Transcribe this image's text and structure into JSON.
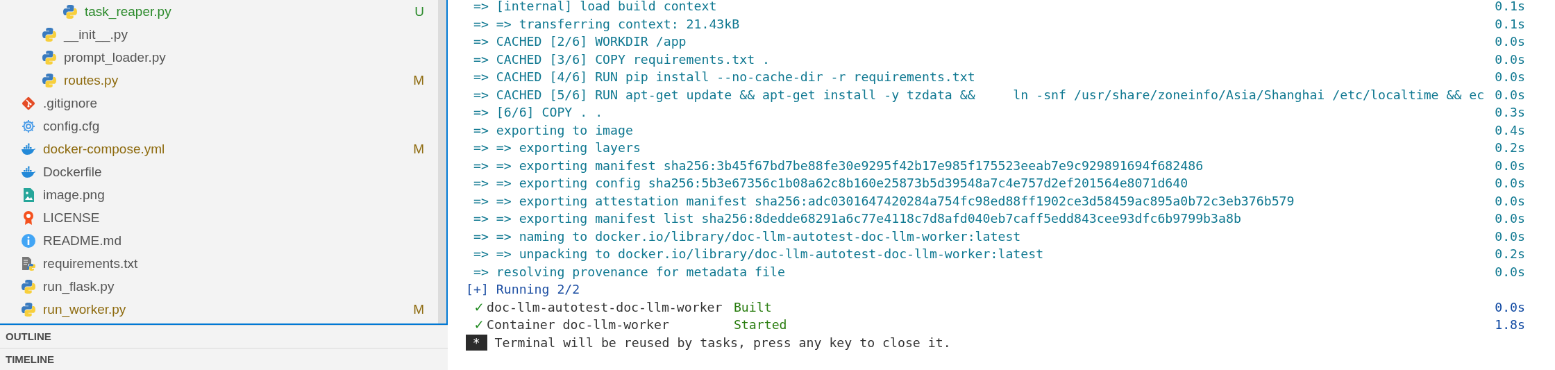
{
  "explorer": {
    "tree": [
      {
        "children": [
          {
            "children": [
              {
                "label": "task_reaper.py",
                "kind": "python",
                "modified": false,
                "untracked": true,
                "badge": "U"
              }
            ]
          },
          {
            "label": "__init__.py",
            "kind": "python",
            "modified": false,
            "untracked": false
          },
          {
            "label": "prompt_loader.py",
            "kind": "python",
            "modified": false,
            "untracked": false
          },
          {
            "label": "routes.py",
            "kind": "python",
            "modified": true,
            "untracked": false,
            "badge": "M"
          }
        ]
      },
      {
        "label": ".gitignore",
        "kind": "git",
        "modified": false,
        "untracked": false
      },
      {
        "label": "config.cfg",
        "kind": "config",
        "modified": false,
        "untracked": false
      },
      {
        "label": "docker-compose.yml",
        "kind": "docker",
        "modified": true,
        "untracked": false,
        "badge": "M"
      },
      {
        "label": "Dockerfile",
        "kind": "docker",
        "modified": false,
        "untracked": false
      },
      {
        "label": "image.png",
        "kind": "image",
        "modified": false,
        "untracked": false
      },
      {
        "label": "LICENSE",
        "kind": "license",
        "modified": false,
        "untracked": false
      },
      {
        "label": "README.md",
        "kind": "readme",
        "modified": false,
        "untracked": false
      },
      {
        "label": "requirements.txt",
        "kind": "requirements",
        "modified": false,
        "untracked": false
      },
      {
        "label": "run_flask.py",
        "kind": "python",
        "modified": false,
        "untracked": false
      },
      {
        "label": "run_worker.py",
        "kind": "python",
        "modified": true,
        "untracked": false,
        "badge": "M"
      }
    ],
    "sections": [
      {
        "label": "OUTLINE"
      },
      {
        "label": "TIMELINE"
      }
    ]
  },
  "terminal": {
    "lines": [
      {
        "kind": "step",
        "text": "=> [internal] load build context",
        "time": "0.1s"
      },
      {
        "kind": "step",
        "text": "=> => transferring context: 21.43kB",
        "time": "0.1s"
      },
      {
        "kind": "step",
        "text": "=> CACHED [2/6] WORKDIR /app",
        "time": "0.0s"
      },
      {
        "kind": "step",
        "text": "=> CACHED [3/6] COPY requirements.txt .",
        "time": "0.0s"
      },
      {
        "kind": "step",
        "text": "=> CACHED [4/6] RUN pip install --no-cache-dir -r requirements.txt",
        "time": "0.0s"
      },
      {
        "kind": "step",
        "text": "=> CACHED [5/6] RUN apt-get update && apt-get install -y tzdata &&     ln -snf /usr/share/zoneinfo/Asia/Shanghai /etc/localtime && ec",
        "time": "0.0s"
      },
      {
        "kind": "step",
        "text": "=> [6/6] COPY . .",
        "time": "0.3s"
      },
      {
        "kind": "step",
        "text": "=> exporting to image",
        "time": "0.4s"
      },
      {
        "kind": "step",
        "text": "=> => exporting layers",
        "time": "0.2s"
      },
      {
        "kind": "step",
        "text": "=> => exporting manifest sha256:3b45f67bd7be88fe30e9295f42b17e985f175523eeab7e9c929891694f682486",
        "time": "0.0s"
      },
      {
        "kind": "step",
        "text": "=> => exporting config sha256:5b3e67356c1b08a62c8b160e25873b5d39548a7c4e757d2ef201564e8071d640",
        "time": "0.0s"
      },
      {
        "kind": "step",
        "text": "=> => exporting attestation manifest sha256:adc0301647420284a754fc98ed88ff1902ce3d58459ac895a0b72c3eb376b579",
        "time": "0.0s"
      },
      {
        "kind": "step",
        "text": "=> => exporting manifest list sha256:8dedde68291a6c77e4118c7d8afd040eb7caff5edd843cee93dfc6b9799b3a8b",
        "time": "0.0s"
      },
      {
        "kind": "step",
        "text": "=> => naming to docker.io/library/doc-llm-autotest-doc-llm-worker:latest",
        "time": "0.0s"
      },
      {
        "kind": "step",
        "text": "=> => unpacking to docker.io/library/doc-llm-autotest-doc-llm-worker:latest",
        "time": "0.2s"
      },
      {
        "kind": "step",
        "text": "=> resolving provenance for metadata file",
        "time": "0.0s"
      },
      {
        "kind": "header",
        "text": "[+] Running 2/2"
      },
      {
        "kind": "service",
        "mark": "✓",
        "name": "doc-llm-autotest-doc-llm-worker",
        "status": "Built",
        "time": "0.0s"
      },
      {
        "kind": "service",
        "mark": "✓",
        "name": "Container doc-llm-worker",
        "status": "Started",
        "time": "1.8s"
      },
      {
        "kind": "notice",
        "marker": "*",
        "text": "Terminal will be reused by tasks, press any key to close it."
      }
    ]
  }
}
